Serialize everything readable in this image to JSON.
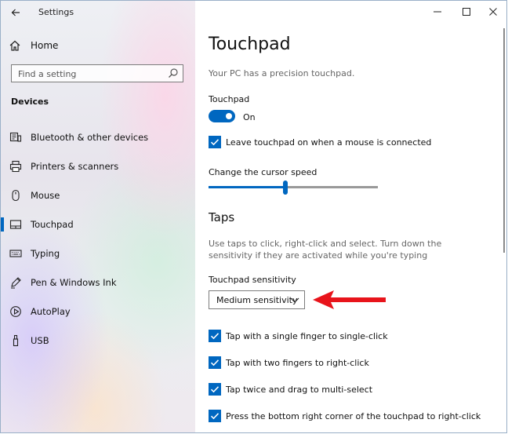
{
  "window": {
    "title": "Settings"
  },
  "sidebar": {
    "home_label": "Home",
    "search_placeholder": "Find a setting",
    "section_title": "Devices",
    "items": [
      {
        "label": "Bluetooth & other devices",
        "icon": "bluetooth-device-icon",
        "active": false
      },
      {
        "label": "Printers & scanners",
        "icon": "printer-icon",
        "active": false
      },
      {
        "label": "Mouse",
        "icon": "mouse-icon",
        "active": false
      },
      {
        "label": "Touchpad",
        "icon": "touchpad-icon",
        "active": true
      },
      {
        "label": "Typing",
        "icon": "keyboard-icon",
        "active": false
      },
      {
        "label": "Pen & Windows Ink",
        "icon": "pen-icon",
        "active": false
      },
      {
        "label": "AutoPlay",
        "icon": "autoplay-icon",
        "active": false
      },
      {
        "label": "USB",
        "icon": "usb-icon",
        "active": false
      }
    ]
  },
  "main": {
    "title": "Touchpad",
    "subtitle": "Your PC has a precision touchpad.",
    "touchpad_toggle": {
      "label": "Touchpad",
      "state_text": "On",
      "on": true
    },
    "leave_on_checkbox": {
      "label": "Leave touchpad on when a mouse is connected",
      "checked": true
    },
    "cursor_speed": {
      "label": "Change the cursor speed",
      "value_fraction": 0.45
    },
    "taps": {
      "heading": "Taps",
      "description": "Use taps to click, right-click and select. Turn down the sensitivity if they are activated while you're typing",
      "sensitivity_label": "Touchpad sensitivity",
      "sensitivity_value": "Medium sensitivity",
      "options": [
        {
          "label": "Tap with a single finger to single-click",
          "checked": true
        },
        {
          "label": "Tap with two fingers to right-click",
          "checked": true
        },
        {
          "label": "Tap twice and drag to multi-select",
          "checked": true
        },
        {
          "label": "Press the bottom right corner of the touchpad to right-click",
          "checked": true
        }
      ]
    }
  },
  "colors": {
    "accent": "#0067c0",
    "annotation_arrow": "#e8141b"
  }
}
